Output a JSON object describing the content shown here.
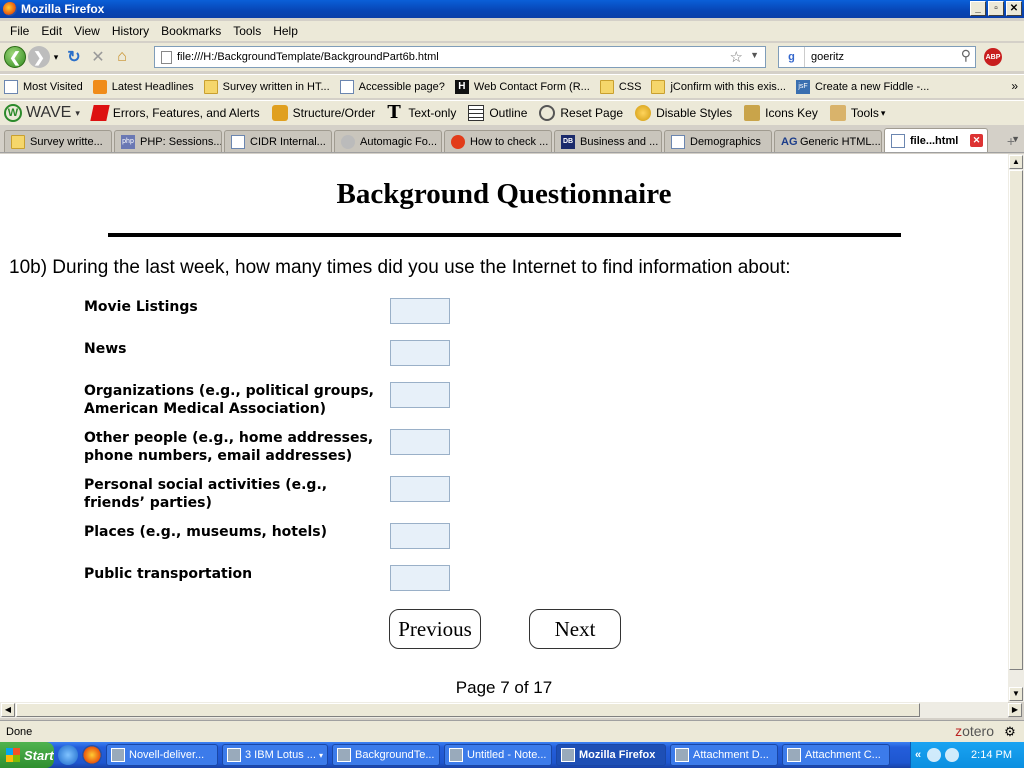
{
  "window": {
    "title": "Mozilla Firefox",
    "min": "_",
    "max": "▫",
    "close": "✕"
  },
  "menu": [
    "File",
    "Edit",
    "View",
    "History",
    "Bookmarks",
    "Tools",
    "Help"
  ],
  "nav": {
    "url": "file:///H:/BackgroundTemplate/BackgroundPart6b.html",
    "search_value": "goeritz",
    "abp_label": "ABP"
  },
  "bookmarks": [
    {
      "label": "Most Visited",
      "icon": "page"
    },
    {
      "label": "Latest Headlines",
      "icon": "rss"
    },
    {
      "label": "Survey written in HT...",
      "icon": "folder"
    },
    {
      "label": "Accessible page?",
      "icon": "page"
    },
    {
      "label": "Web Contact Form (R...",
      "icon": "h"
    },
    {
      "label": "CSS",
      "icon": "folder"
    },
    {
      "label": "jConfirm with this exis...",
      "icon": "folder"
    },
    {
      "label": "Create a new Fiddle -...",
      "icon": "jsf"
    }
  ],
  "wave": {
    "logo": "WAVE",
    "items": [
      "Errors, Features, and Alerts",
      "Structure/Order",
      "Text-only",
      "Outline",
      "Reset Page",
      "Disable Styles",
      "Icons Key",
      "Tools"
    ]
  },
  "tabs": [
    {
      "label": "Survey writte...",
      "icon": "folder"
    },
    {
      "label": "PHP: Sessions...",
      "icon": "php"
    },
    {
      "label": "CIDR Internal...",
      "icon": "page"
    },
    {
      "label": "Automagic Fo...",
      "icon": "auto"
    },
    {
      "label": "How to check ...",
      "icon": "how"
    },
    {
      "label": "Business and ...",
      "icon": "db"
    },
    {
      "label": "Demographics",
      "icon": "page"
    },
    {
      "label": "Generic HTML...",
      "icon": "ag"
    },
    {
      "label": "file...html",
      "icon": "page",
      "active": true
    }
  ],
  "page": {
    "title": "Background Questionnaire",
    "question": "10b) During the last week, how many times did you use the Internet to find information about:",
    "items": [
      "Movie Listings",
      "News",
      "Organizations (e.g., political groups, American Medical Association)",
      "Other people (e.g., home addresses, phone numbers, email addresses)",
      "Personal social activities (e.g., friends’ parties)",
      "Places (e.g., museums, hotels)",
      "Public transportation"
    ],
    "previous_label": "Previous",
    "next_label": "Next",
    "page_info": "Page 7 of 17"
  },
  "status": {
    "text": "Done",
    "zotero_z": "z",
    "zotero_rest": "otero"
  },
  "taskbar": {
    "start": "Start",
    "tasks": [
      "Novell-deliver...",
      "3 IBM Lotus ...",
      "BackgroundTe...",
      "Untitled - Note...",
      "Mozilla Firefox",
      "Attachment D...",
      "Attachment C..."
    ],
    "active_task": 4,
    "clock": "2:14 PM"
  }
}
